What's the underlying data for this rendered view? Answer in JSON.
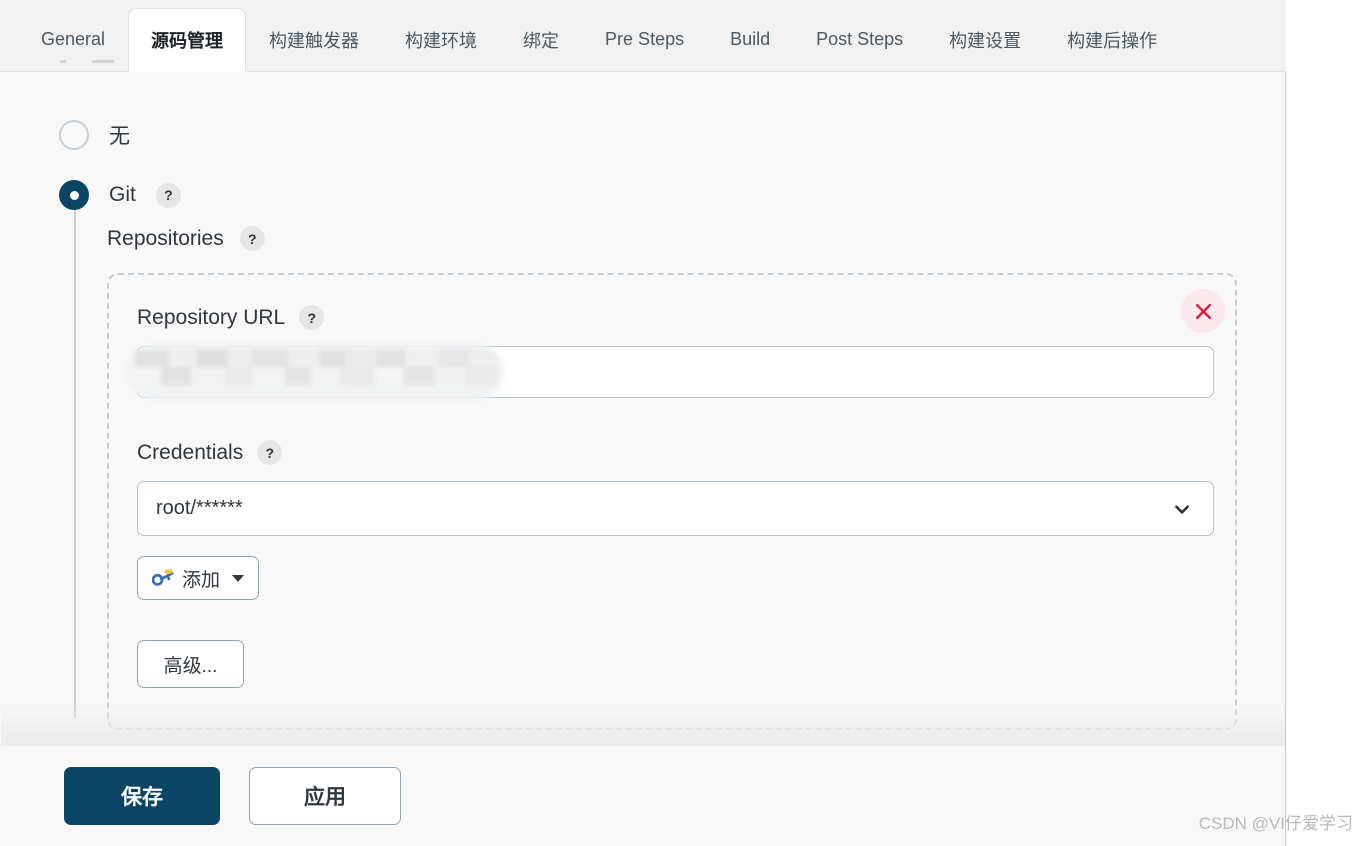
{
  "tabs": [
    {
      "label": "General",
      "active": false
    },
    {
      "label": "源码管理",
      "active": true
    },
    {
      "label": "构建触发器",
      "active": false
    },
    {
      "label": "构建环境",
      "active": false
    },
    {
      "label": "绑定",
      "active": false
    },
    {
      "label": "Pre Steps",
      "active": false
    },
    {
      "label": "Build",
      "active": false
    },
    {
      "label": "Post Steps",
      "active": false
    },
    {
      "label": "构建设置",
      "active": false
    },
    {
      "label": "构建后操作",
      "active": false
    }
  ],
  "scm": {
    "none_option": "无",
    "git_option": "Git",
    "help_glyph": "?",
    "repositories_label": "Repositories"
  },
  "repository": {
    "url_label": "Repository URL",
    "url_value": ".git",
    "url_redacted": true,
    "credentials_label": "Credentials",
    "credentials_value": "root/******",
    "add_button_label": "添加",
    "advanced_button_label": "高级...",
    "delete_icon": "close-icon"
  },
  "actions": {
    "save_label": "保存",
    "apply_label": "应用"
  },
  "watermark": "CSDN @VI仔爱学习",
  "colors": {
    "accent": "#0b4566",
    "panel_bg": "#f8f8f8",
    "tabbar_bg": "#f1f1f1",
    "border": "#b6c2cc",
    "dashed_border": "#c5cdd4",
    "danger": "#d81b44",
    "danger_bg": "#fae8ec",
    "help_badge_bg": "#e6e6e6"
  }
}
